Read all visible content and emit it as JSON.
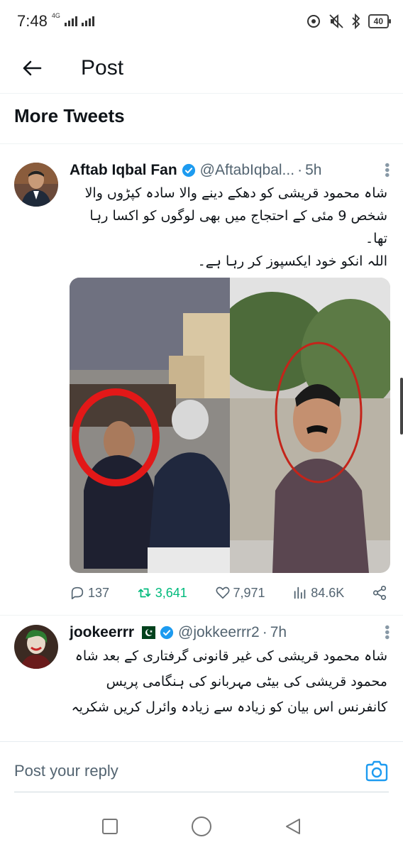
{
  "status_bar": {
    "time": "7:48",
    "network": "4G",
    "battery": "40"
  },
  "header": {
    "back_icon": "arrow-left-icon",
    "title": "Post"
  },
  "section": {
    "title": "More Tweets"
  },
  "tweets": [
    {
      "author": "Aftab Iqbal Fan",
      "handle": "@AftabIqbal...",
      "time": "5h",
      "body": "شاہ محمود قریشی کو دھکے دینے والا سادہ کپڑوں والا شخص 9 مئی کے احتجاج میں بھی لوگوں کو اکسا رہا تھا۔\nاللہ انکو خود ایکسپوز کر رہا ہے۔",
      "replies": "137",
      "retweets": "3,641",
      "likes": "7,971",
      "views": "84.6K"
    },
    {
      "author": "jookeerrr",
      "handle": "@jokkeerrr2",
      "time": "7h",
      "body": "شاہ محمود قریشی کی غیر قانونی گرفتاری کے بعد شاہ محمود قریشی کی بیٹی مہربانو کی ہنگامی پریس کانفرنس اس بیان کو زیادہ سے زیادہ وائرل کریں شکریہ"
    }
  ],
  "reply": {
    "placeholder": "Post your reply",
    "camera_icon": "camera-icon"
  },
  "colors": {
    "accent": "#1d9bf0",
    "retweet": "#00ba7c",
    "muted": "#536471"
  }
}
